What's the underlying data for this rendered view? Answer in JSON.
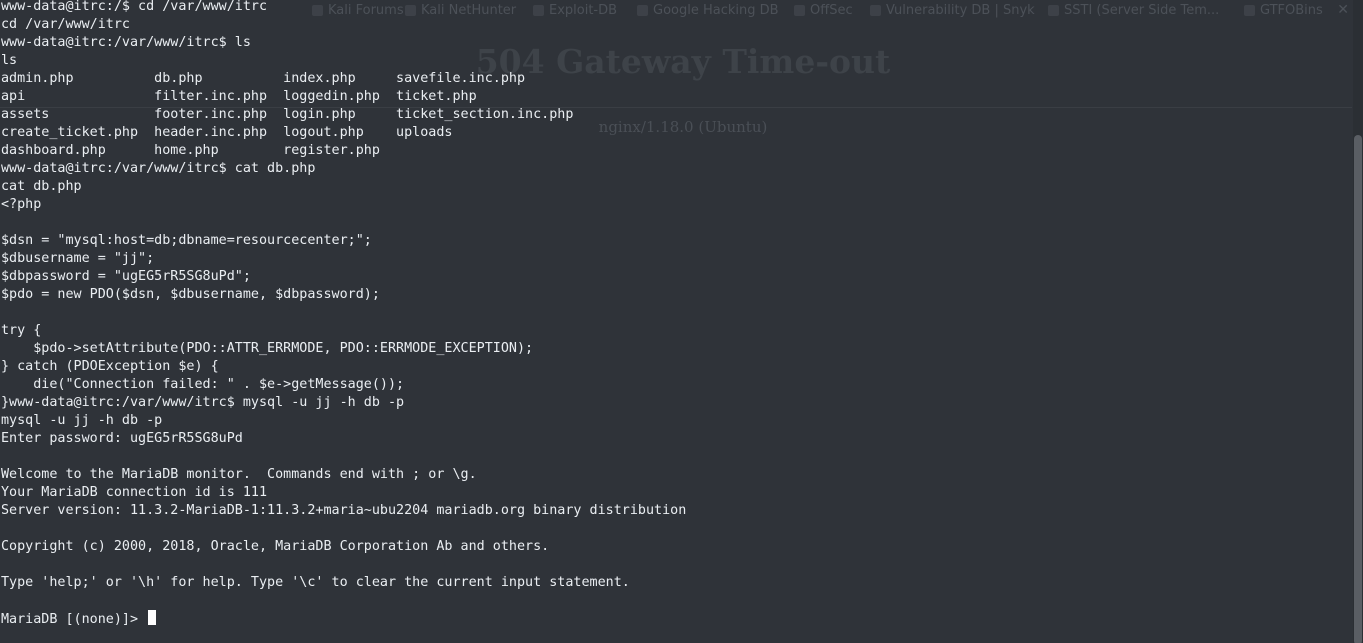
{
  "browser": {
    "bookmarks": [
      "Kali Forums",
      "Kali NetHunter",
      "Exploit-DB",
      "Google Hacking DB",
      "OffSec",
      "Vulnerability DB | Snyk",
      "SSTI (Server Side Tem...",
      "GTFOBins"
    ],
    "page_heading": "504 Gateway Time-out",
    "server_footer": "nginx/1.18.0 (Ubuntu)"
  },
  "terminal": {
    "lines": [
      "www-data@itrc:/$ cd /var/www/itrc",
      "cd /var/www/itrc",
      "www-data@itrc:/var/www/itrc$ ls",
      "ls",
      "admin.php          db.php          index.php     savefile.inc.php",
      "api                filter.inc.php  loggedin.php  ticket.php",
      "assets             footer.inc.php  login.php     ticket_section.inc.php",
      "create_ticket.php  header.inc.php  logout.php    uploads",
      "dashboard.php      home.php        register.php",
      "www-data@itrc:/var/www/itrc$ cat db.php",
      "cat db.php",
      "<?php",
      "",
      "$dsn = \"mysql:host=db;dbname=resourcecenter;\";",
      "$dbusername = \"jj\";",
      "$dbpassword = \"ugEG5rR5SG8uPd\";",
      "$pdo = new PDO($dsn, $dbusername, $dbpassword);",
      "",
      "try {",
      "    $pdo->setAttribute(PDO::ATTR_ERRMODE, PDO::ERRMODE_EXCEPTION);",
      "} catch (PDOException $e) {",
      "    die(\"Connection failed: \" . $e->getMessage());",
      "}www-data@itrc:/var/www/itrc$ mysql -u jj -h db -p",
      "mysql -u jj -h db -p",
      "Enter password: ugEG5rR5SG8uPd",
      "",
      "Welcome to the MariaDB monitor.  Commands end with ; or \\g.",
      "Your MariaDB connection id is 111",
      "Server version: 11.3.2-MariaDB-1:11.3.2+maria~ubu2204 mariadb.org binary distribution",
      "",
      "Copyright (c) 2000, 2018, Oracle, MariaDB Corporation Ab and others.",
      "",
      "Type 'help;' or '\\h' for help. Type '\\c' to clear the current input statement.",
      "",
      "MariaDB [(none)]> "
    ]
  },
  "colors": {
    "background": "#2f3339",
    "text": "#eaeef2",
    "cursor": "#ffffff"
  }
}
